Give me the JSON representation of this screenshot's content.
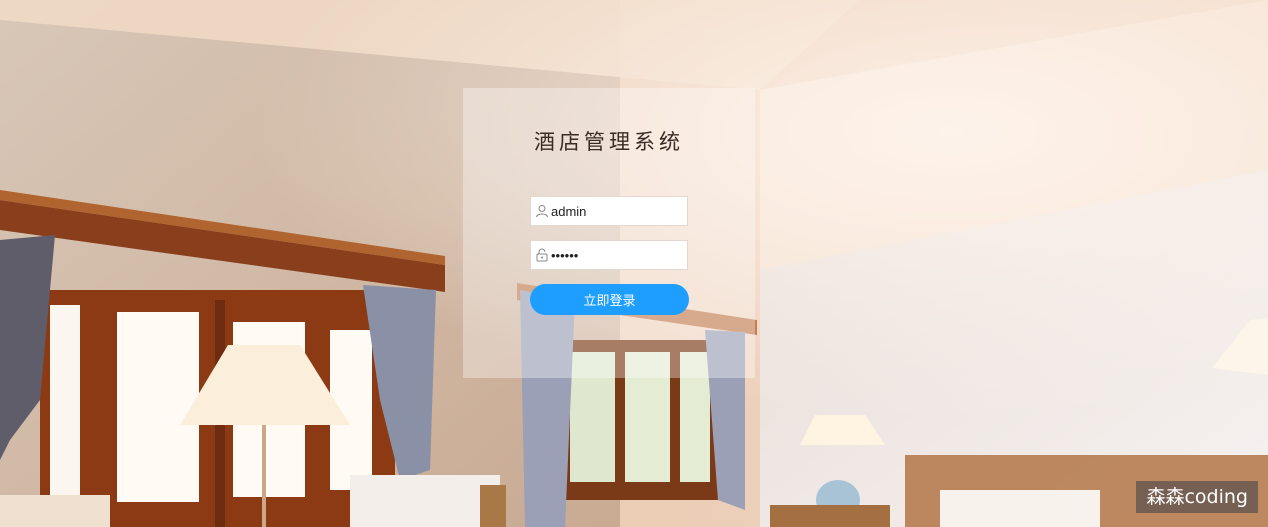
{
  "login": {
    "title": "酒店管理系统",
    "username_value": "admin",
    "password_value": "••••••",
    "submit_label": "立即登录"
  },
  "icons": {
    "username": "user-icon",
    "password": "lock-icon"
  },
  "watermark": {
    "text": "森森coding"
  },
  "colors": {
    "accent": "#1e9fff",
    "panel": "rgba(255,255,255,0.34)"
  }
}
